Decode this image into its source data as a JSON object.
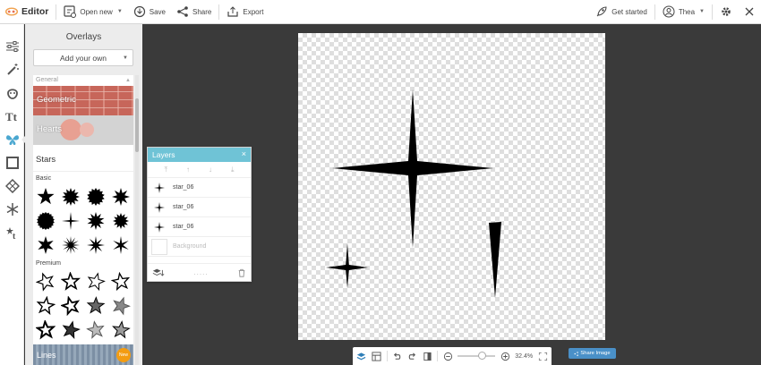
{
  "topbar": {
    "app_name": "Editor",
    "open_new": "Open new",
    "save": "Save",
    "share": "Share",
    "export": "Export",
    "get_started": "Get started",
    "user": "Thea"
  },
  "panel": {
    "title": "Overlays",
    "add_own": "Add your own",
    "general_label": "General",
    "tiles": [
      "Geometric",
      "Hearts"
    ],
    "stars_title": "Stars",
    "basic_label": "Basic",
    "premium_label": "Premium",
    "lines_tile": "Lines",
    "new_badge": "New"
  },
  "layers": {
    "title": "Layers",
    "rows": [
      "star_06",
      "star_06",
      "star_06"
    ],
    "background": "Background",
    "dots": "....."
  },
  "bottombar": {
    "zoom": "32.4%",
    "zoom_fraction": 0.55
  },
  "share_image": "Share Image",
  "colors": {
    "layers_header": "#6fc3d6",
    "share_button": "#4a90c8",
    "accent_rail": "#4aa7d0",
    "workspace": "#3a3a3a"
  }
}
